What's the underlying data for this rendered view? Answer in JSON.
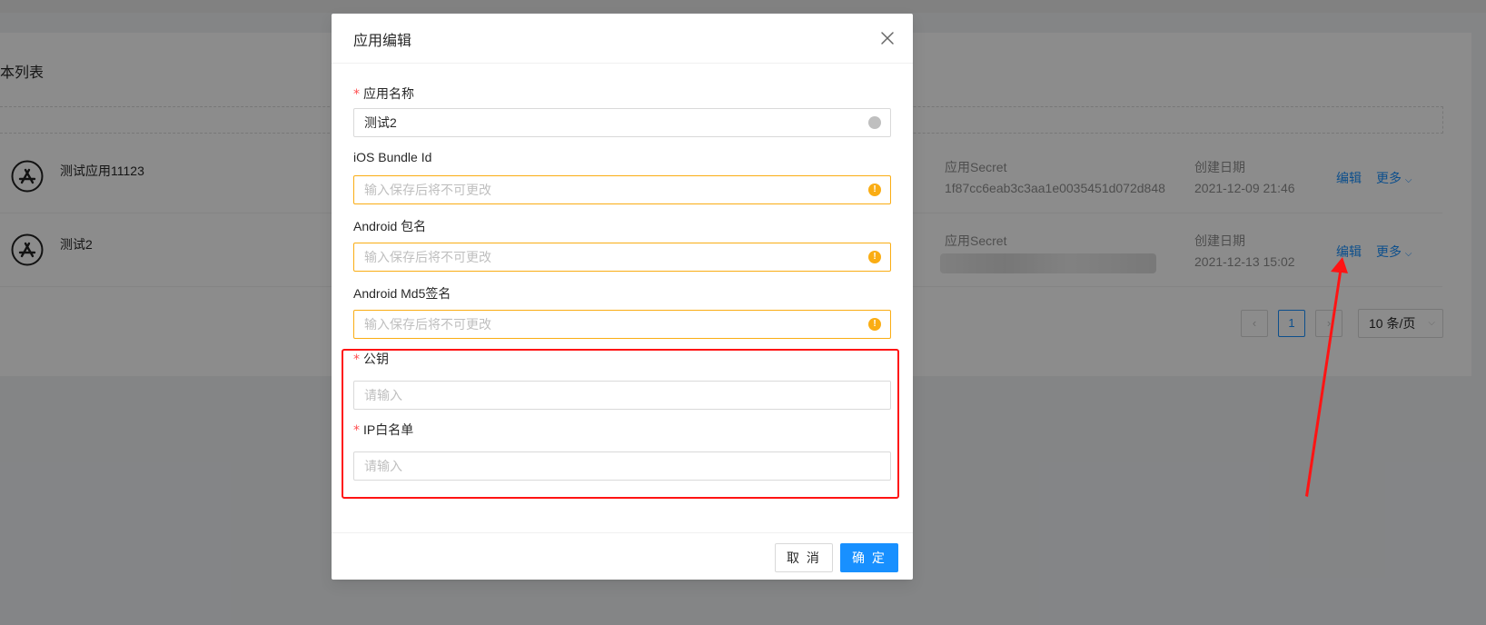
{
  "background": {
    "list_title": "本列表",
    "rows": [
      {
        "name": "测试应用11123",
        "secret_label": "应用Secret",
        "secret_value": "1f87cc6eab3c3aa1e0035451d072d848",
        "date_label": "创建日期",
        "date_value": "2021-12-09 21:46",
        "edit": "编辑",
        "more": "更多"
      },
      {
        "name": "测试2",
        "secret_label": "应用Secret",
        "secret_value": "",
        "date_label": "创建日期",
        "date_value": "2021-12-13 15:02",
        "edit": "编辑",
        "more": "更多"
      }
    ],
    "pagination": {
      "current_page": "1",
      "page_size": "10 条/页"
    }
  },
  "modal": {
    "title": "应用编辑",
    "fields": [
      {
        "label": "应用名称",
        "required": true,
        "value": "测试2",
        "placeholder": ""
      },
      {
        "label": "iOS Bundle Id",
        "required": false,
        "value": "",
        "placeholder": "输入保存后将不可更改"
      },
      {
        "label": "Android 包名",
        "required": false,
        "value": "",
        "placeholder": "输入保存后将不可更改"
      },
      {
        "label": "Android Md5签名",
        "required": false,
        "value": "",
        "placeholder": "输入保存后将不可更改"
      },
      {
        "label": "公钥",
        "required": true,
        "value": "",
        "placeholder": "请输入"
      },
      {
        "label": "IP白名单",
        "required": true,
        "value": "",
        "placeholder": "请输入"
      }
    ],
    "cancel_label": "取 消",
    "ok_label": "确 定"
  },
  "colors": {
    "primary": "#1890ff",
    "warning": "#faad14",
    "annotation_red": "#ff1414"
  }
}
